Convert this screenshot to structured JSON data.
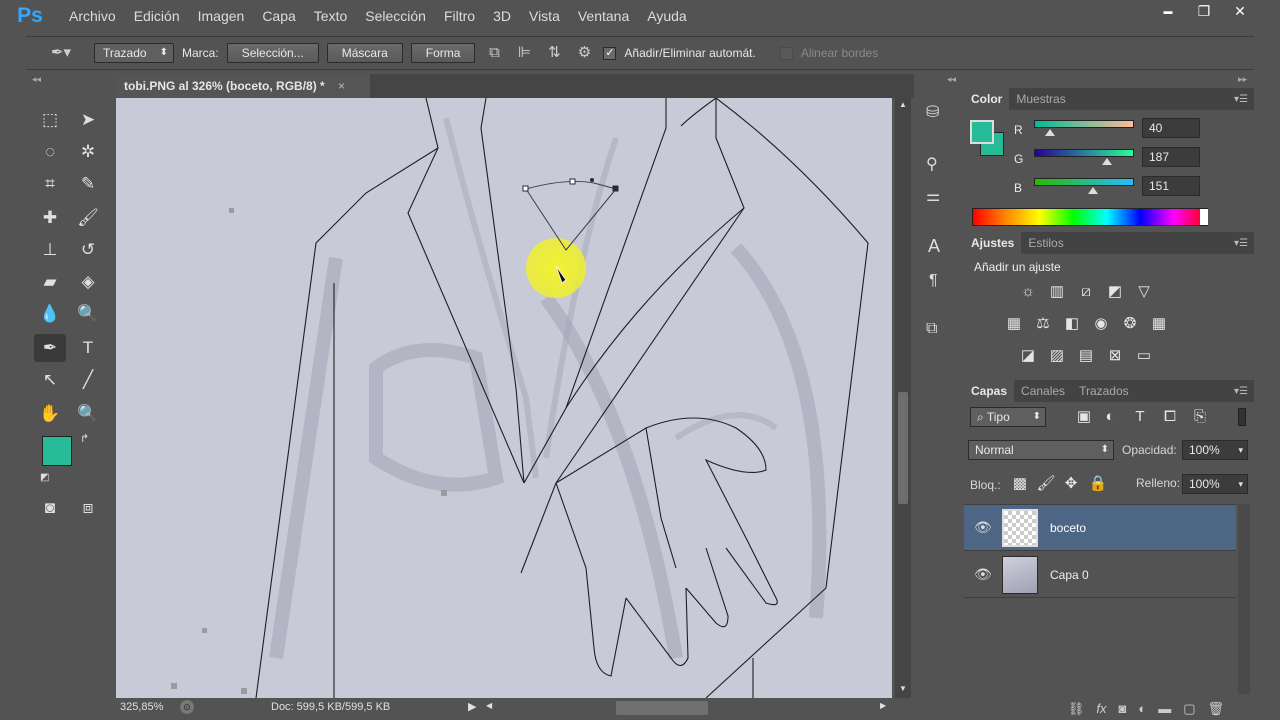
{
  "app": {
    "logo": "Ps"
  },
  "menu": [
    "Archivo",
    "Edición",
    "Imagen",
    "Capa",
    "Texto",
    "Selección",
    "Filtro",
    "3D",
    "Vista",
    "Ventana",
    "Ayuda"
  ],
  "window_controls": {
    "minimize": "▬",
    "restore": "❐",
    "close": "✕"
  },
  "options_bar": {
    "mode_select": "Trazado",
    "marca_label": "Marca:",
    "seleccion_btn": "Selección...",
    "mascara_btn": "Máscara",
    "forma_btn": "Forma",
    "auto_add_label": "Añadir/Eliminar automát.",
    "auto_add_checked": true,
    "align_edges_label": "Alinear bordes",
    "align_edges_checked": false
  },
  "document": {
    "tab_title": "tobi.PNG al 326% (boceto, RGB/8) *",
    "close_glyph": "×"
  },
  "status": {
    "zoom": "325,85%",
    "doc": "Doc: 599,5 KB/599,5 KB"
  },
  "colors": {
    "foreground": "#28bb97",
    "background": "#28bb97",
    "selected_layer": "#4e6686"
  },
  "color_panel": {
    "tabs": [
      "Color",
      "Muestras"
    ],
    "channels": [
      {
        "label": "R",
        "value": "40",
        "fraction": 0.16
      },
      {
        "label": "G",
        "value": "187",
        "fraction": 0.73
      },
      {
        "label": "B",
        "value": "151",
        "fraction": 0.59
      }
    ]
  },
  "adjustments_panel": {
    "tabs": [
      "Ajustes",
      "Estilos"
    ],
    "heading": "Añadir un ajuste"
  },
  "layers_panel": {
    "tabs": [
      "Capas",
      "Canales",
      "Trazados"
    ],
    "filter_select": "Tipo",
    "blend_mode": "Normal",
    "opacity_label": "Opacidad:",
    "opacity_value": "100%",
    "lock_label": "Bloq.:",
    "fill_label": "Relleno:",
    "fill_value": "100%",
    "layers": [
      {
        "name": "boceto",
        "selected": true
      },
      {
        "name": "Capa 0",
        "selected": false
      }
    ]
  }
}
